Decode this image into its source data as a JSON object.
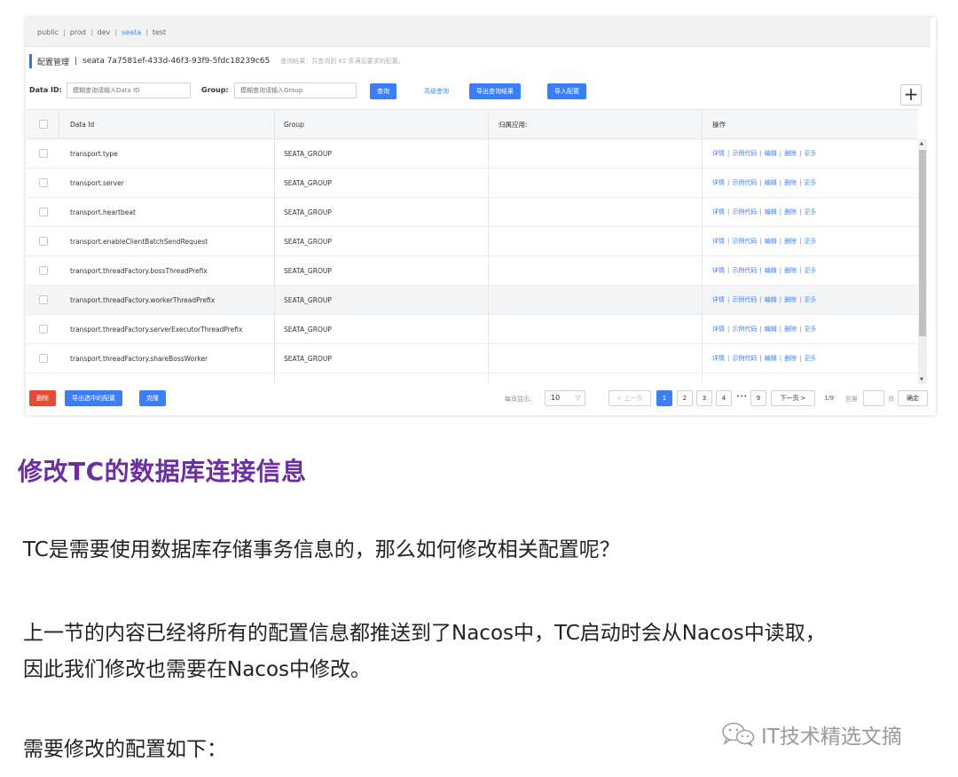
{
  "namespaces": [
    {
      "label": "public",
      "active": false
    },
    {
      "label": "prod",
      "active": false
    },
    {
      "label": "dev",
      "active": false
    },
    {
      "label": "seata",
      "active": true
    },
    {
      "label": "test",
      "active": false
    }
  ],
  "header": {
    "title": "配置管理",
    "separator": "|",
    "namespace_id": "seata  7a7581ef-433d-46f3-93f9-5fdc18239c65",
    "result_hint": "查询结果：共查询到 81 条满足要求的配置。"
  },
  "search": {
    "data_id_label": "Data ID:",
    "data_id_placeholder": "模糊查询请输入Data ID",
    "group_label": "Group:",
    "group_placeholder": "模糊查询请输入Group",
    "query_button": "查询",
    "advanced_link": "高级查询",
    "export_button": "导出查询结果",
    "import_button": "导入配置",
    "add_button": "+"
  },
  "table": {
    "columns": [
      "Data Id",
      "Group",
      "归属应用:",
      "操作"
    ],
    "rows": [
      {
        "data_id": "transport.type",
        "group": "SEATA_GROUP",
        "app": ""
      },
      {
        "data_id": "transport.server",
        "group": "SEATA_GROUP",
        "app": ""
      },
      {
        "data_id": "transport.heartbeat",
        "group": "SEATA_GROUP",
        "app": ""
      },
      {
        "data_id": "transport.enableClientBatchSendRequest",
        "group": "SEATA_GROUP",
        "app": ""
      },
      {
        "data_id": "transport.threadFactory.bossThreadPrefix",
        "group": "SEATA_GROUP",
        "app": ""
      },
      {
        "data_id": "transport.threadFactory.workerThreadPrefix",
        "group": "SEATA_GROUP",
        "app": ""
      },
      {
        "data_id": "transport.threadFactory.serverExecutorThreadPrefix",
        "group": "SEATA_GROUP",
        "app": ""
      },
      {
        "data_id": "transport.threadFactory.shareBossWorker",
        "group": "SEATA_GROUP",
        "app": ""
      }
    ],
    "actions": [
      "详情",
      "示例代码",
      "编辑",
      "删除",
      "更多"
    ],
    "action_separator": "|"
  },
  "footer": {
    "delete_button": "删除",
    "export_selected_button": "导出选中的配置",
    "clone_button": "克隆",
    "page_size_label": "每页显示:",
    "page_size": "10",
    "prev_button": "< 上一页",
    "pages": [
      "1",
      "2",
      "3",
      "4"
    ],
    "ellipsis": "•••",
    "last_page": "9",
    "next_button": "下一页 >",
    "page_status": "1/9",
    "goto_label": "到第",
    "page_unit": "页",
    "confirm_button": "确定"
  },
  "article": {
    "heading": "修改TC的数据库连接信息",
    "paragraphs": [
      [
        "TC是需要使用数据库存储事务信息的，那么如何修改相关配置呢？"
      ],
      [
        "上一节的内容已经将所有的配置信息都推送到了Nacos中，TC启动时会从Nacos中读取，",
        "因此我们修改也需要在Nacos中修改。"
      ],
      [
        "需要修改的配置如下："
      ]
    ]
  },
  "watermark": {
    "text": "IT技术精选文摘",
    "icon": "wechat-icon"
  },
  "colors": {
    "primary": "#3c7ef5",
    "danger": "#e64b33",
    "heading": "#6b2fa0",
    "watermark": "#9a9a9a"
  }
}
